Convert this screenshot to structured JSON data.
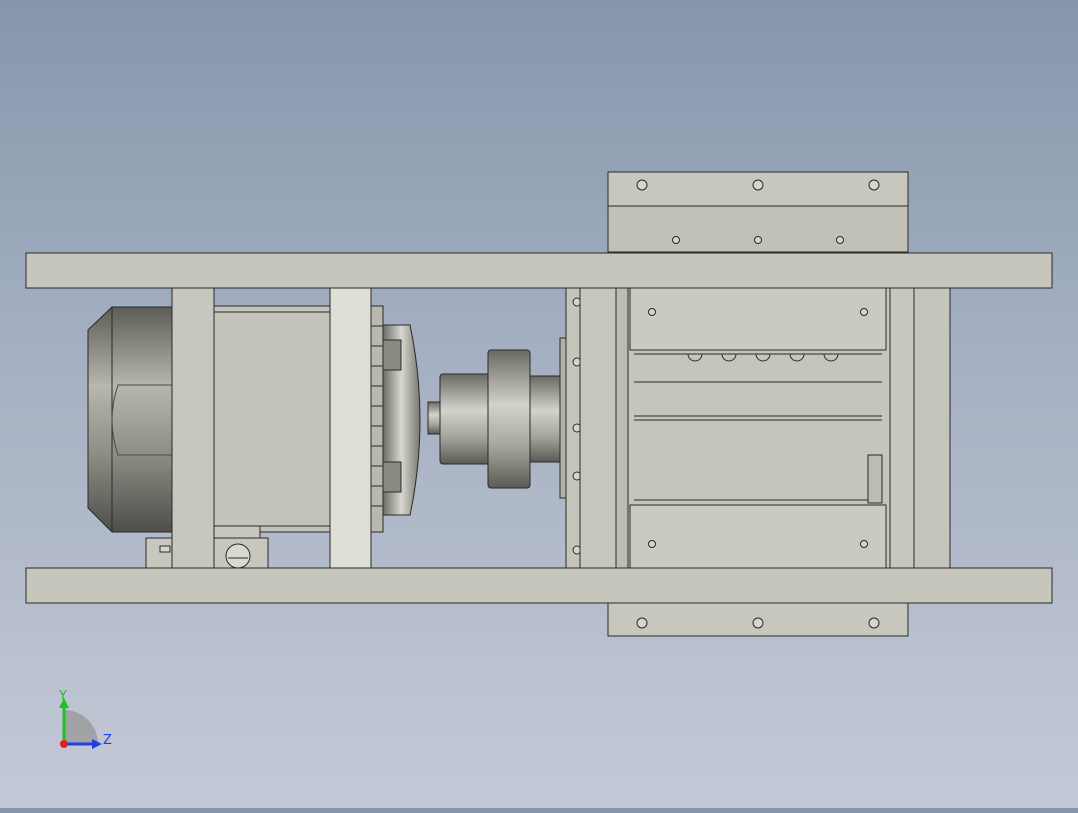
{
  "viewport": {
    "background_top": "#8796ac",
    "background_bottom": "#c4c9d7"
  },
  "model": {
    "frame_color": "#c7c6bd",
    "edge_color": "#2a2a2a",
    "motor_shell_color": "#808078",
    "coupling_color": "#9a9a92"
  },
  "triad": {
    "y_label": "Y",
    "z_label": "Z",
    "y_color": "#22c022",
    "z_color": "#2040e0",
    "x_color": "#e02020"
  }
}
